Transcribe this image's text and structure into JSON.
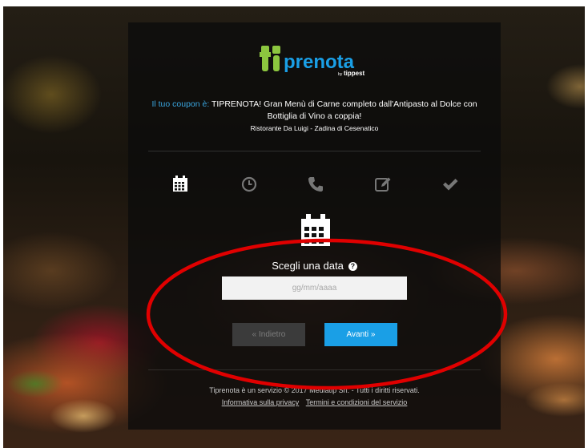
{
  "logo": {
    "text_ti": "ti",
    "text_main": "prenota",
    "text_by": "by",
    "text_brand": "tippest"
  },
  "coupon": {
    "lead": "Il tuo coupon è:",
    "title": "TIPRENOTA! Gran Menù di Carne completo dall'Antipasto al Dolce con Bottiglia di Vino a coppia!",
    "restaurant": "Ristorante Da Luigi - Zadina di Cesenatico"
  },
  "steps": [
    {
      "icon": "calendar-icon",
      "state": "active"
    },
    {
      "icon": "clock-icon",
      "state": "inactive"
    },
    {
      "icon": "phone-icon",
      "state": "inactive"
    },
    {
      "icon": "edit-icon",
      "state": "inactive"
    },
    {
      "icon": "check-icon",
      "state": "inactive"
    }
  ],
  "form": {
    "label": "Scegli una data",
    "help_symbol": "?",
    "date_placeholder": "gg/mm/aaaa",
    "back_label": "« Indietro",
    "next_label": "Avanti »"
  },
  "footer": {
    "copyright": "Tiprenota è un servizio © 2017 Mediatip Srl. - Tutti i diritti riservati.",
    "privacy_link": "Informativa sulla privacy",
    "terms_link": "Termini e condizioni del servizio"
  },
  "colors": {
    "accent_blue": "#1a9fe6",
    "logo_green": "#8cc63f",
    "annotation_red": "#e00000"
  }
}
